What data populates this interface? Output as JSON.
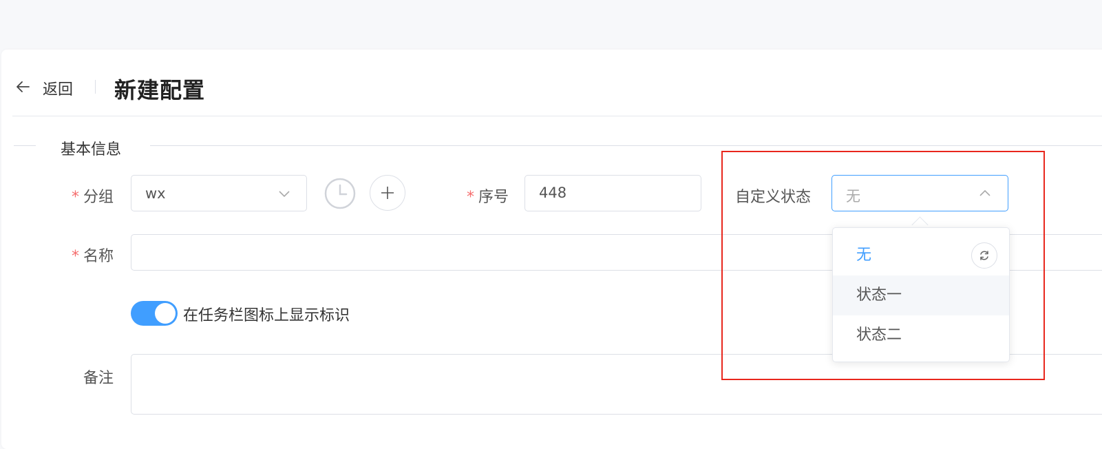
{
  "header": {
    "back_label": "返回",
    "title": "新建配置"
  },
  "section": {
    "title": "基本信息"
  },
  "form": {
    "group": {
      "required_mark": "*",
      "label": "分组",
      "value": "wx"
    },
    "serial": {
      "required_mark": "*",
      "label": "序号",
      "value": "448"
    },
    "custom_status": {
      "label": "自定义状态",
      "placeholder": "无",
      "options": [
        {
          "label": "无",
          "state": "selected"
        },
        {
          "label": "状态一",
          "state": "hover"
        },
        {
          "label": "状态二",
          "state": "normal"
        }
      ]
    },
    "name": {
      "required_mark": "*",
      "label": "名称",
      "value": ""
    },
    "taskbar_toggle": {
      "label": "在任务栏图标上显示标识",
      "on": true
    },
    "remark": {
      "label": "备注",
      "value": ""
    }
  },
  "colors": {
    "accent": "#409eff",
    "required": "#f56c6c",
    "highlight_box": "#e8261c"
  },
  "icons": {
    "back": "arrow-left-icon",
    "group_dropdown": "chevron-down-icon",
    "history": "clock-icon",
    "add": "plus-icon",
    "status_dropdown": "chevron-up-icon",
    "refresh": "refresh-icon"
  }
}
